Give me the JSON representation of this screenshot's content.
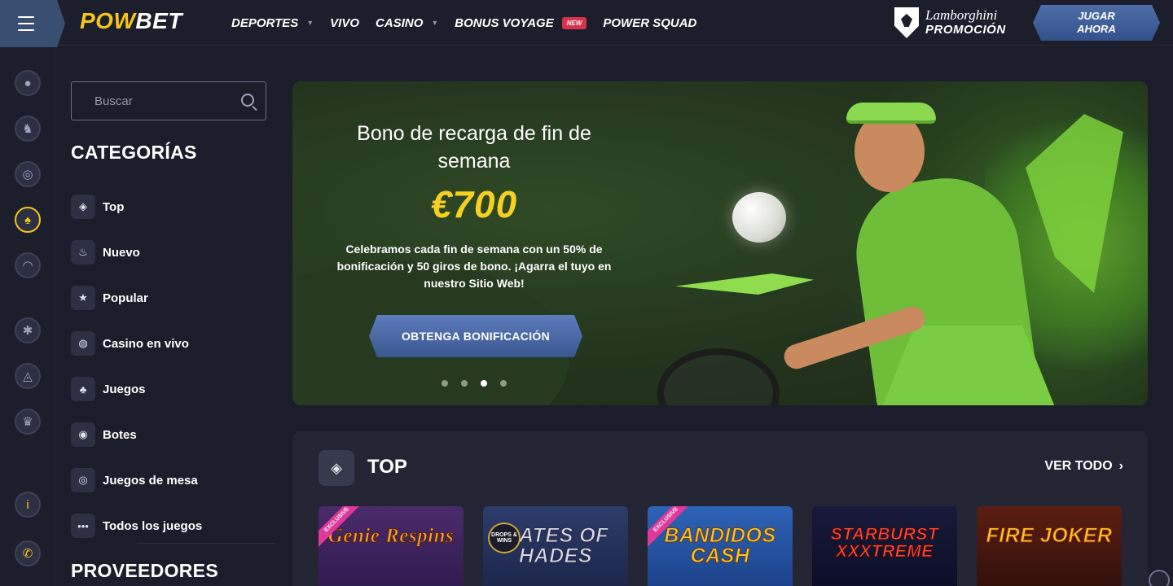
{
  "header": {
    "logo_primary": "POW",
    "logo_secondary": "BET",
    "nav": [
      {
        "label": "DEPORTES",
        "has_dropdown": true
      },
      {
        "label": "VIVO",
        "has_dropdown": false
      },
      {
        "label": "CASINO",
        "has_dropdown": true
      },
      {
        "label": "BONUS VOYAGE",
        "badge": "NEW"
      },
      {
        "label": "POWER SQUAD"
      }
    ],
    "promo_brand": "Lamborghini",
    "promo_label": "PROMOCIÓN",
    "cta_line1": "JUGAR",
    "cta_line2": "AHORA"
  },
  "rail": {
    "icons": [
      "soccer-ball-icon",
      "horse-racing-icon",
      "esports-icon",
      "casino-spade-icon",
      "live-signal-icon",
      "roulette-icon",
      "lottery-icon",
      "trophy-icon",
      "info-icon",
      "support-phone-icon"
    ],
    "active_index": 3,
    "info_glyph": "i"
  },
  "sidebar": {
    "search_placeholder": "Buscar",
    "categories_title": "CATEGORÍAS",
    "categories": [
      {
        "label": "Top",
        "icon": "diamond-icon",
        "glyph": "◈"
      },
      {
        "label": "Nuevo",
        "icon": "flame-icon",
        "glyph": "♨"
      },
      {
        "label": "Popular",
        "icon": "star-icon",
        "glyph": "★"
      },
      {
        "label": "Casino en vivo",
        "icon": "globe-icon",
        "glyph": "◍"
      },
      {
        "label": "Juegos",
        "icon": "cherries-icon",
        "glyph": "♣"
      },
      {
        "label": "Botes",
        "icon": "map-pin-icon",
        "glyph": "◉"
      },
      {
        "label": "Juegos de mesa",
        "icon": "chips-icon",
        "glyph": "◎"
      },
      {
        "label": "Todos los juegos",
        "icon": "more-dots-icon",
        "glyph": "•••"
      }
    ],
    "providers_title": "PROVEEDORES"
  },
  "banner": {
    "title": "Bono de recarga de fin de semana",
    "amount": "€700",
    "description": "Celebramos cada fin de semana con un 50% de bonificación y 50 giros de bono. ¡Agarra el tuyo en nuestro Sitio Web!",
    "cta_label": "OBTENGA BONIFICACIÓN",
    "slides_total": 4,
    "active_slide": 3
  },
  "top_section": {
    "title": "TOP",
    "icon_glyph": "◈",
    "see_all_label": "VER TODO",
    "see_all_chevron": "›",
    "games": [
      {
        "title": "Genie Respins",
        "ribbon": "EXCLUSIVE"
      },
      {
        "title": "GATES OF HADES",
        "badge": "DROPS & WINS"
      },
      {
        "title": "BANDIDOS CASH",
        "ribbon": "EXCLUSIVE"
      },
      {
        "title": "STARBURST XXXTREME"
      },
      {
        "title": "FIRE JOKER"
      }
    ]
  }
}
